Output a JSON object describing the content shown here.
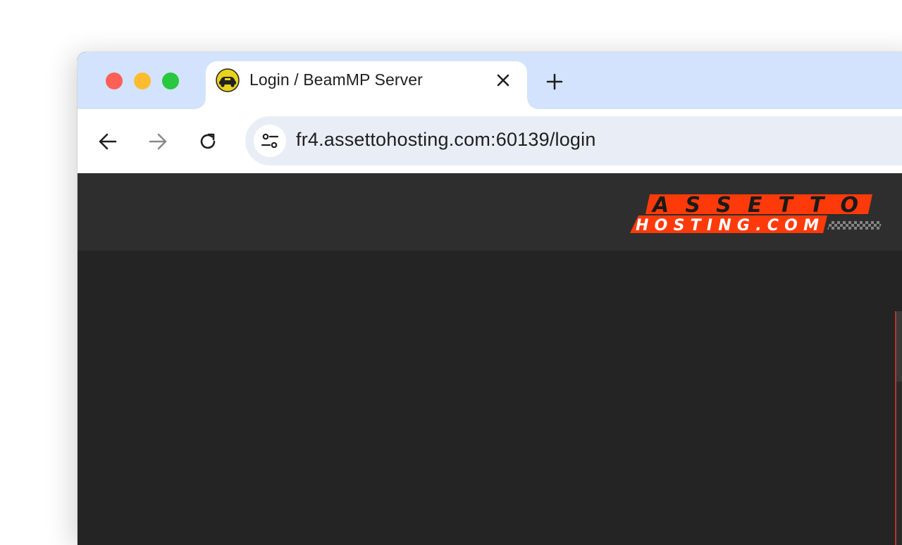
{
  "window": {
    "controls": [
      "close",
      "minimize",
      "zoom"
    ],
    "colors": {
      "close": "#fe5f57",
      "minimize": "#febc2e",
      "zoom": "#28c840",
      "tabstrip": "#d3e3fd"
    }
  },
  "tab": {
    "title": "Login / BeamMP Server",
    "favicon": "beammp-favicon-icon",
    "close_icon": "close-icon"
  },
  "new_tab_icon": "plus-icon",
  "nav": {
    "back_icon": "arrow-left-icon",
    "forward_icon": "arrow-right-icon",
    "reload_icon": "reload-icon"
  },
  "address_bar": {
    "url": "fr4.assettohosting.com:60139/login",
    "site_info_icon": "tune-icon",
    "highlight_color": "#e0534a"
  },
  "page": {
    "header_bg": "#2e2e2e",
    "body_bg": "#242424",
    "logo": {
      "line1": "ASSETTO",
      "line2": "HOSTING.COM",
      "color": "#ff3a0a"
    }
  }
}
